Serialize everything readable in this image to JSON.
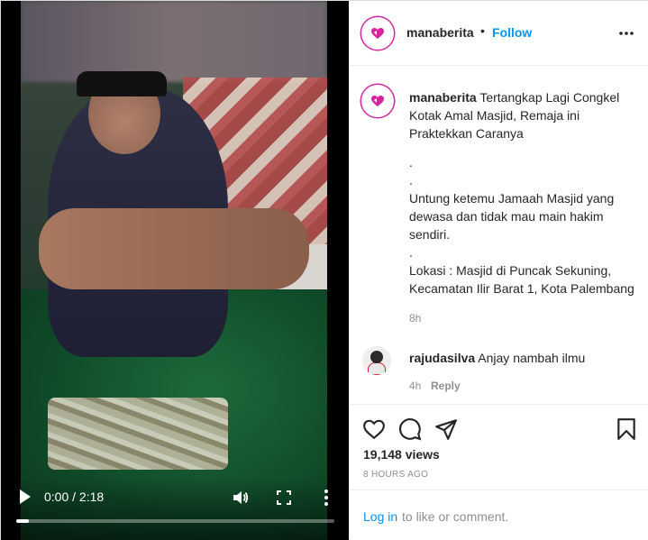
{
  "video": {
    "time": "0:00 / 2:18",
    "progress": 0.04
  },
  "header": {
    "username": "manaberita",
    "dot": "•",
    "follow_label": "Follow"
  },
  "caption": {
    "username": "manaberita",
    "title": "Tertangkap Lagi Congkel Kotak Amal Masjid, Remaja ini Praktekkan Caranya",
    "dot1": ".",
    "dot2": ".",
    "para1": "Untung ketemu Jamaah Masjid yang dewasa dan tidak mau main hakim sendiri.",
    "dot3": ".",
    "para2": "Lokasi : Masjid di Puncak Sekuning, Kecamatan Ilir Barat 1, Kota Palembang",
    "time": "8h"
  },
  "comment": {
    "username": "rajudasilva",
    "text": "Anjay nambah ilmu",
    "time": "4h",
    "reply_label": "Reply"
  },
  "stats": {
    "views": "19,148 views",
    "ago": "8 HOURS AGO"
  },
  "login": {
    "link": "Log in",
    "rest": "to like or comment."
  },
  "colors": {
    "accent": "#0095f6",
    "text": "#262626",
    "muted": "#8e8e8e",
    "brand": "#d6249f"
  },
  "icons": {
    "like": "heart-icon",
    "comment": "comment-icon",
    "share": "share-icon",
    "save": "bookmark-icon",
    "play": "play-icon",
    "volume": "volume-icon",
    "fullscreen": "fullscreen-icon",
    "more": "more-icon"
  }
}
